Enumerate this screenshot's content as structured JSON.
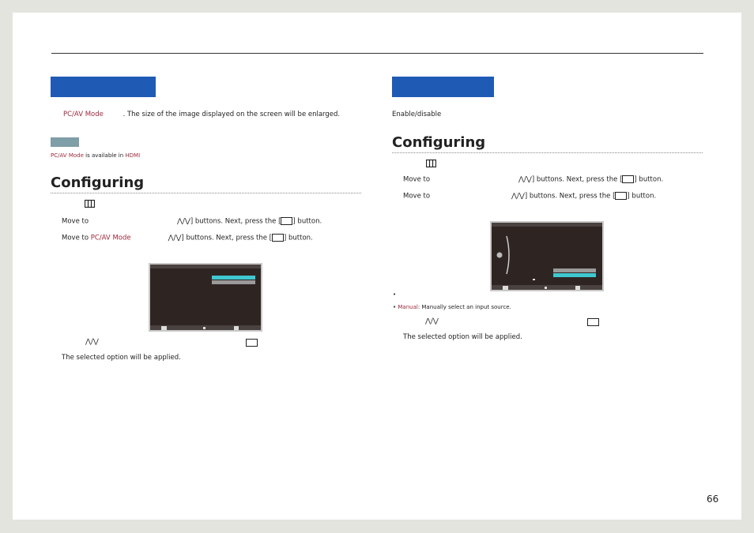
{
  "left": {
    "intro_mode": "PC/AV Mode",
    "intro_text": ". The size of the image displayed on the screen will be enlarged.",
    "note_mode": "PC/AV Mode",
    "note_mid": " is available in ",
    "note_hdmi": "HDMI",
    "heading": "Configuring",
    "step2_pre": "Move to",
    "step2_post": "] buttons. Next, press the [",
    "step2_end": "] button.",
    "step3_pre": "Move to ",
    "step3_mode": "PC/AV Mode",
    "step3_post": "] buttons. Next, press the [",
    "step3_end": "] button.",
    "applied": "The selected option will be applied."
  },
  "right": {
    "intro": "Enable/disable",
    "heading": "Configuring",
    "step2_pre": "Move to",
    "step2_post": "] buttons. Next, press the [",
    "step2_end": "] button.",
    "step3_pre": "Move to",
    "step3_post": "] buttons. Next, press the [",
    "step3_end": "] button.",
    "bullet_manual": "Manual",
    "bullet_text": ": Manually select an input source.",
    "applied": "The selected option will be applied."
  },
  "symbols": {
    "updown": "⋀/⋁",
    "bullet": "•"
  },
  "page_number": "66",
  "colors": {
    "accent": "#9b2a3b",
    "blue_bar": "#1f5bb5",
    "osd_bg": "#2e2523",
    "osd_select": "#40c8d0"
  }
}
